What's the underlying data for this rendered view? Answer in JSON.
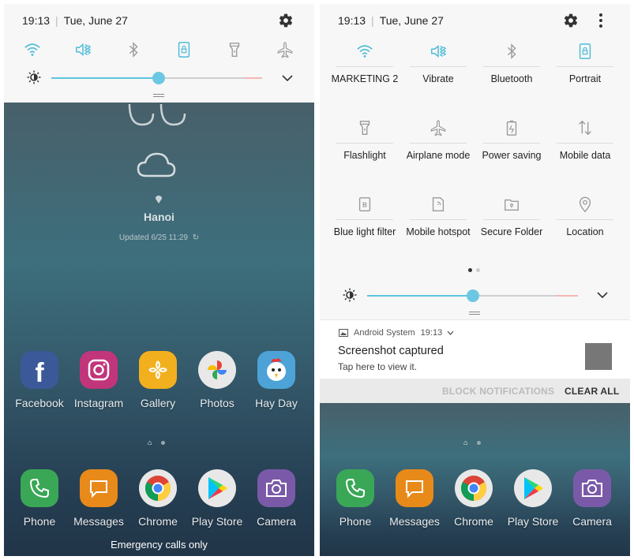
{
  "left": {
    "status": {
      "time": "19:13",
      "date": "Tue, June 27"
    },
    "weather": {
      "city": "Hanoi",
      "updated": "Updated 6/25 11:29"
    },
    "apps_row": [
      {
        "name": "Facebook",
        "color": "#3b5998"
      },
      {
        "name": "Instagram",
        "color": "#c1357b"
      },
      {
        "name": "Gallery",
        "color": "#f2b01e"
      },
      {
        "name": "Photos",
        "color": "#e8e8e8"
      },
      {
        "name": "Hay Day",
        "color": "#4da3d8"
      }
    ],
    "dock": [
      {
        "name": "Phone",
        "color": "#3aa757"
      },
      {
        "name": "Messages",
        "color": "#e88a1a"
      },
      {
        "name": "Chrome",
        "color": "#e8e8e8"
      },
      {
        "name": "Play Store",
        "color": "#e8e8e8"
      },
      {
        "name": "Camera",
        "color": "#7a5aa8"
      }
    ],
    "emergency": "Emergency calls only",
    "brightness": 0.51
  },
  "right": {
    "status": {
      "time": "19:13",
      "date": "Tue, June 27"
    },
    "tiles": [
      {
        "icon": "wifi-icon",
        "label": "MARKETING 2",
        "active": true
      },
      {
        "icon": "vibrate-icon",
        "label": "Vibrate",
        "active": true
      },
      {
        "icon": "bluetooth-icon",
        "label": "Bluetooth",
        "active": false
      },
      {
        "icon": "portrait-icon",
        "label": "Portrait",
        "active": true
      },
      {
        "icon": "flashlight-icon",
        "label": "Flashlight",
        "active": false
      },
      {
        "icon": "airplane-icon",
        "label": "Airplane mode",
        "active": false
      },
      {
        "icon": "power-saving-icon",
        "label": "Power saving",
        "active": false
      },
      {
        "icon": "mobile-data-icon",
        "label": "Mobile data",
        "active": false
      },
      {
        "icon": "blue-light-icon",
        "label": "Blue light filter",
        "active": false
      },
      {
        "icon": "hotspot-icon",
        "label": "Mobile hotspot",
        "active": false
      },
      {
        "icon": "secure-folder-icon",
        "label": "Secure Folder",
        "active": false
      },
      {
        "icon": "location-icon",
        "label": "Location",
        "active": false
      }
    ],
    "brightness": 0.5,
    "notification": {
      "app": "Android System",
      "time": "19:13",
      "title": "Screenshot captured",
      "text": "Tap here to view it.",
      "block_label": "BLOCK NOTIFICATIONS",
      "clear_label": "CLEAR ALL"
    },
    "dock": [
      {
        "name": "Phone",
        "color": "#3aa757"
      },
      {
        "name": "Messages",
        "color": "#e88a1a"
      },
      {
        "name": "Chrome",
        "color": "#e8e8e8"
      },
      {
        "name": "Play Store",
        "color": "#e8e8e8"
      },
      {
        "name": "Camera",
        "color": "#7a5aa8"
      }
    ]
  },
  "colors": {
    "accent": "#4fbcd8",
    "inactive_icon": "#9a9a9a"
  }
}
